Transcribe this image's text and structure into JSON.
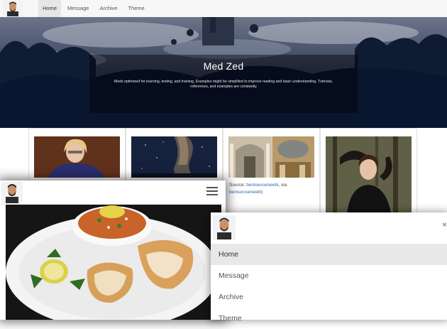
{
  "nav": {
    "items": [
      {
        "label": "Home",
        "active": true
      },
      {
        "label": "Message",
        "active": false
      },
      {
        "label": "Archive",
        "active": false
      },
      {
        "label": "Theme",
        "active": false
      }
    ]
  },
  "hero": {
    "title": "Med Zed",
    "description": "Meds optimized for learning, testing, and training. Examples might be simplified to improve reading and basic understanding. Tutorials, references, and examples are constantly"
  },
  "cards": [
    {
      "image": "portrait-woman-blonde-photo"
    },
    {
      "image": "milky-way-photo"
    },
    {
      "image": "palace-interior-photo",
      "source_prefix": "Source: ",
      "source_link_1": "benisevseneebi",
      "source_sep": ", via",
      "source_link_2": "benisevseneebi)"
    },
    {
      "image": "woman-in-forest-photo"
    }
  ],
  "mobile_food": {
    "image": "food-plate-photo",
    "menu_icon": "hamburger-icon"
  },
  "mobile_menu": {
    "close_glyph": "×",
    "items": [
      {
        "label": "Home",
        "active": true
      },
      {
        "label": "Message",
        "active": false
      },
      {
        "label": "Archive",
        "active": false
      },
      {
        "label": "Theme",
        "active": false
      }
    ]
  },
  "colors": {
    "hero_bg": "#0c1833",
    "link": "#2a6db5",
    "active_bg": "#e6e6e6"
  }
}
